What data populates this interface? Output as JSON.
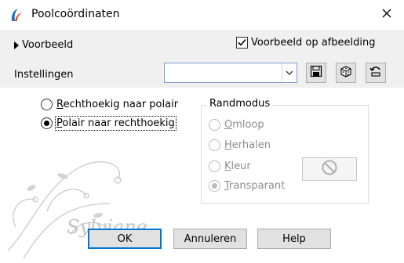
{
  "window": {
    "title": "Poolcoördinaten"
  },
  "preview": {
    "toggle_label": "Voorbeeld",
    "on_image_label": "Voorbeeld op afbeelding",
    "on_image_checked": true
  },
  "settings": {
    "label": "Instellingen",
    "combo_value": ""
  },
  "conversion": {
    "options": [
      {
        "label": "Rechthoekig naar polair",
        "selected": false
      },
      {
        "label": "Polair naar rechthoekig",
        "selected": true
      }
    ]
  },
  "edge_mode": {
    "title": "Randmodus",
    "options": [
      {
        "label": "Omloop",
        "selected": false
      },
      {
        "label": "Herhalen",
        "selected": false
      },
      {
        "label": "Kleur",
        "selected": false
      },
      {
        "label": "Transparant",
        "selected": true
      }
    ]
  },
  "watermark_text": "Sylviane",
  "buttons": {
    "ok": "OK",
    "cancel": "Annuleren",
    "help": "Help"
  },
  "colors": {
    "accent": "#0078d7",
    "panel": "#ffffff",
    "chrome": "#f0f0f0",
    "disabled": "#8d8d8d"
  }
}
